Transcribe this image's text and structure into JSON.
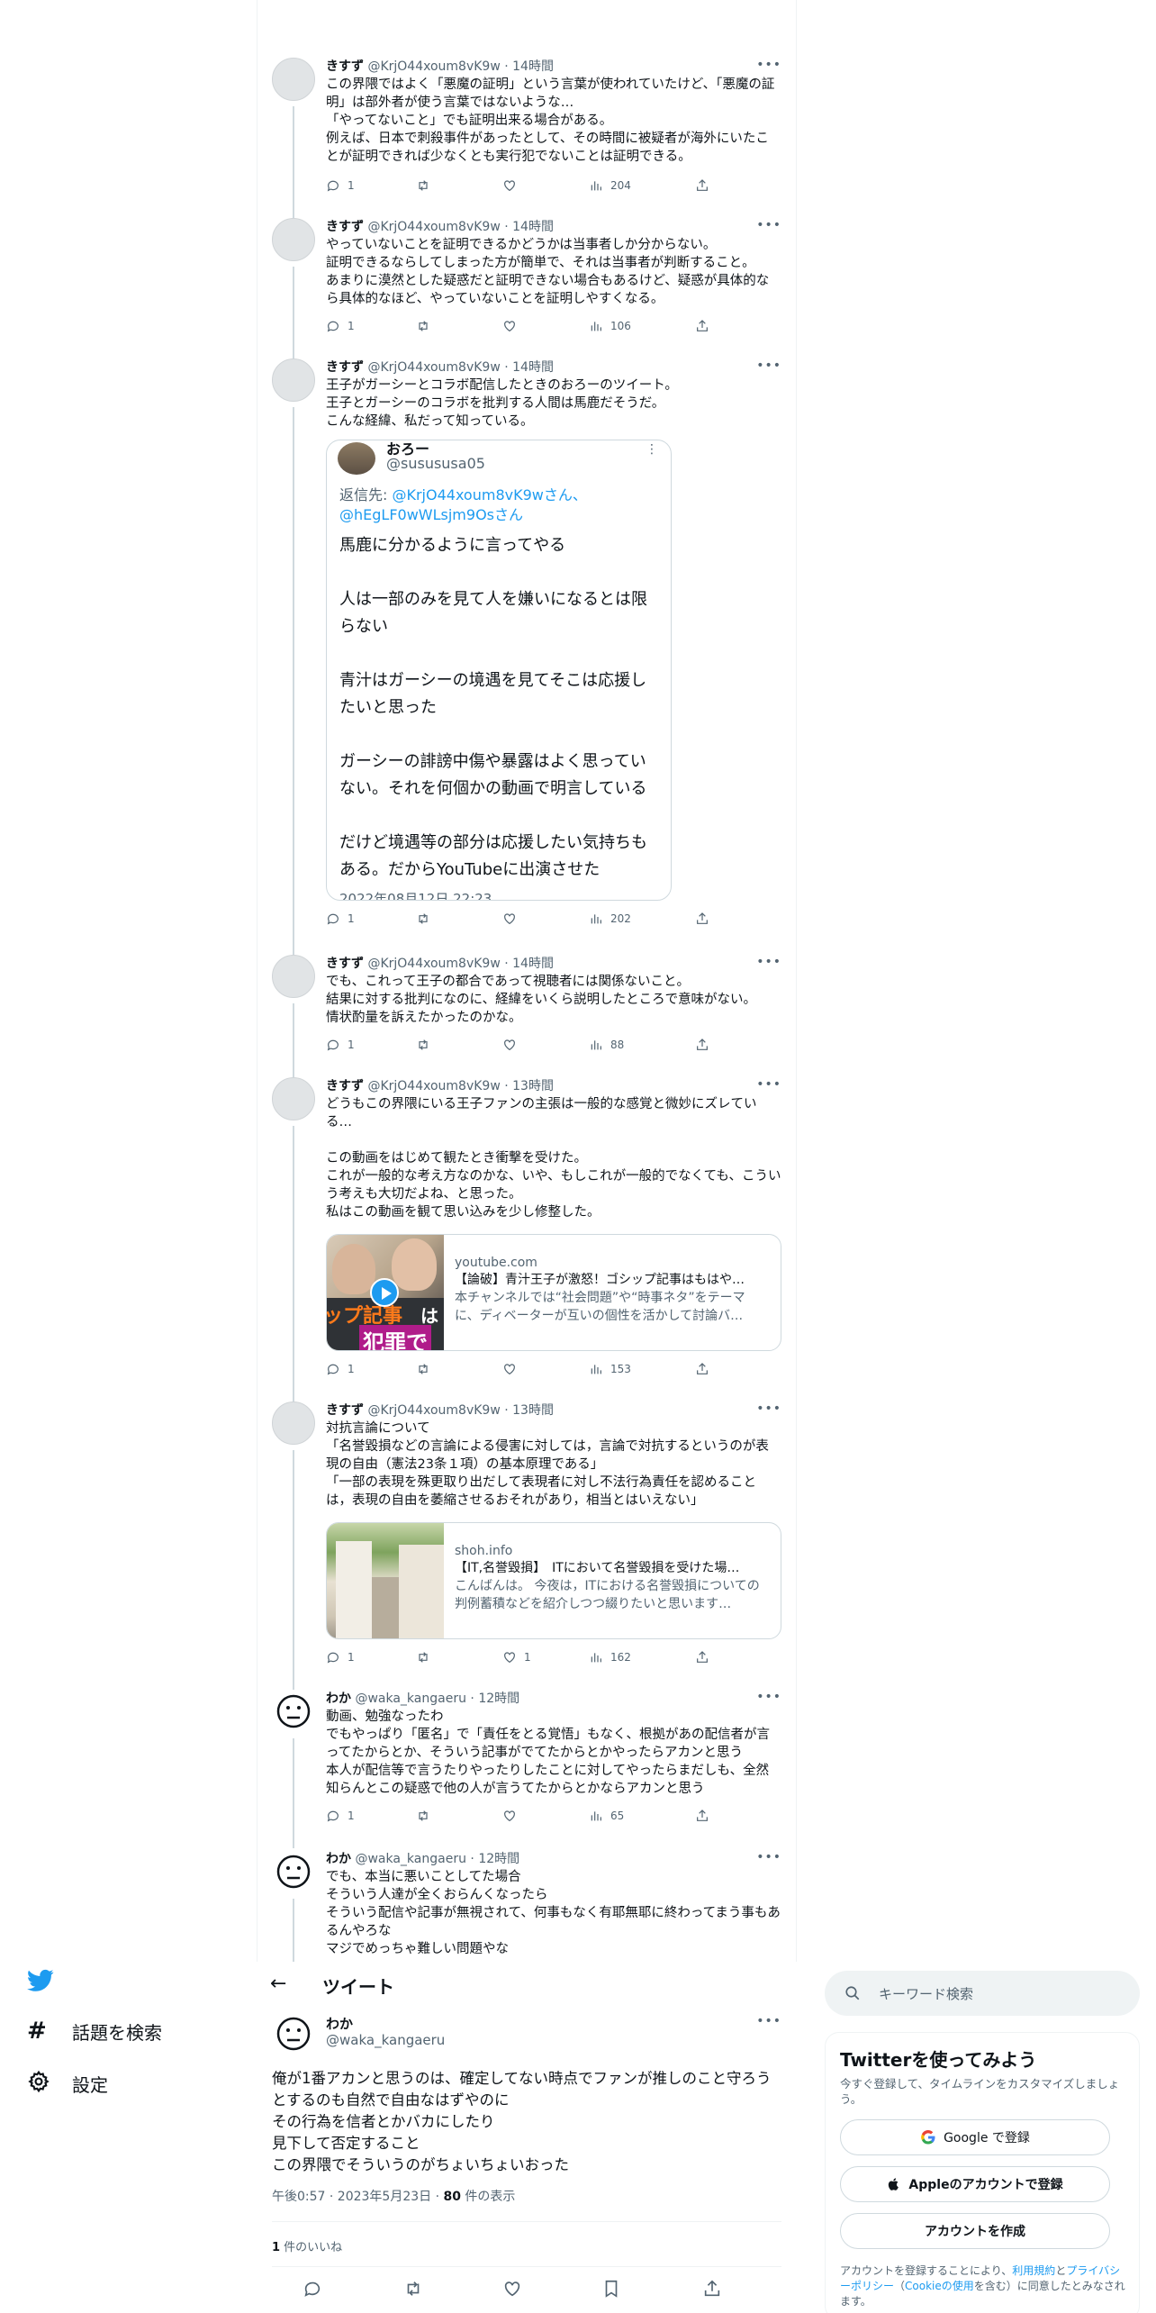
{
  "thread": [
    {
      "name": "きすず",
      "handle": "@KrjO44xoum8vK9w",
      "time": "14時間",
      "text": "この界隈ではよく「悪魔の証明」という言葉が使われていたけど、「悪魔の証明」は部外者が使う言葉ではないような…\n「やってないこと」でも証明出来る場合がある。\n例えば、日本で刺殺事件があったとして、その時間に被疑者が海外にいたことが証明できれば少なくとも実行犯でないことは証明できる。",
      "replies": "1",
      "retweets": "",
      "likes": "",
      "views": "204"
    },
    {
      "name": "きすず",
      "handle": "@KrjO44xoum8vK9w",
      "time": "14時間",
      "text": "やっていないことを証明できるかどうかは当事者しか分からない。\n証明できるならしてしまった方が簡単で、それは当事者が判断すること。\nあまりに漠然とした疑惑だと証明できない場合もあるけど、疑惑が具体的なら具体的なほど、やっていないことを証明しやすくなる。",
      "replies": "1",
      "retweets": "",
      "likes": "",
      "views": "106"
    },
    {
      "name": "きすず",
      "handle": "@KrjO44xoum8vK9w",
      "time": "14時間",
      "text": "王子がガーシーとコラボ配信したときのおろーのツイート。\n王子とガーシーのコラボを批判する人間は馬鹿だそうだ。\nこんな経緯、私だって知っている。",
      "replies": "1",
      "retweets": "",
      "likes": "",
      "views": "202",
      "quote": {
        "name": "おろー",
        "handle": "@susususa05",
        "reply_prefix": "返信先: ",
        "reply_to_1": "@KrjO44xoum8vK9wさん、",
        "reply_to_2": "@hEgLF0wWLsjm9Osさん",
        "text": "馬鹿に分かるように言ってやる\n\n人は一部のみを見て人を嫌いになるとは限らない\n\n青汁はガーシーの境遇を見てそこは応援したいと思った\n\nガーシーの誹謗中傷や暴露はよく思っていない。それを何個かの動画で明言している\n\nだけど境遇等の部分は応援したい気持ちもある。だからYouTubeに出演させた",
        "date": "2022年08月12日 22:23"
      }
    },
    {
      "name": "きすず",
      "handle": "@KrjO44xoum8vK9w",
      "time": "14時間",
      "text": "でも、これって王子の都合であって視聴者には関係ないこと。\n結果に対する批判になのに、経緯をいくら説明したところで意味がない。\n情状酌量を訴えたかったのかな。",
      "replies": "1",
      "retweets": "",
      "likes": "",
      "views": "88"
    },
    {
      "name": "きすず",
      "handle": "@KrjO44xoum8vK9w",
      "time": "13時間",
      "text": "どうもこの界隈にいる王子ファンの主張は一般的な感覚と微妙にズレている…\n\nこの動画をはじめて観たとき衝撃を受けた。\nこれが一般的な考え方なのかな、いや、もしこれが一般的でなくても、こういう考えも大切だよね、と思った。\n私はこの動画を観て思い込みを少し修整した。",
      "replies": "1",
      "retweets": "",
      "likes": "",
      "views": "153",
      "card": {
        "domain": "youtube.com",
        "title": "【論破】青汁王子が激怒！ゴシップ記事はもはや…",
        "desc": "本チャンネルでは“社会問題”や“時事ネタ”をテーマに、ディベーターが互いの個性を活かして討論バ…",
        "thumb_text_1": "ップ記事",
        "thumb_text_2": "は",
        "thumb_text_3": "犯罪で"
      }
    },
    {
      "name": "きすず",
      "handle": "@KrjO44xoum8vK9w",
      "time": "13時間",
      "text": "対抗言論について\n「名誉毀損などの言論による侵害に対しては，言論で対抗するというのが表現の自由（憲法23条１項）の基本原理である」\n「一部の表現を殊更取り出だして表現者に対し不法行為責任を認めることは，表現の自由を萎縮させるおそれがあり，相当とはいえない」",
      "replies": "1",
      "retweets": "",
      "likes": "1",
      "views": "162",
      "card": {
        "domain": "shoh.info",
        "title": "【IT,名誉毀損】　ITにおいて名誉毀損を受けた場…",
        "desc": "こんばんは。 今夜は，ITにおける名誉毀損についての判例蓄積などを紹介しつつ綴りたいと思います…"
      }
    },
    {
      "name": "わか",
      "handle": "@waka_kangaeru",
      "time": "12時間",
      "text": "動画、勉強なったわ\nでもやっぱり「匿名」で「責任をとる覚悟」もなく、根拠があの配信者が言ってたからとか、そういう記事がでてたからとかやったらアカンと思う\n本人が配信等で言うたりやったりしたことに対してやったらまだしも、全然知らんとこの疑惑で他の人が言うてたからとかならアカンと思う",
      "replies": "1",
      "retweets": "",
      "likes": "",
      "views": "65"
    },
    {
      "name": "わか",
      "handle": "@waka_kangaeru",
      "time": "12時間",
      "text": "でも、本当に悪いことしてた場合\nそういう人達が全くおらんくなったら\nそういう配信や記事が無視されて、何事もなく有耶無耶に終わってまう事もあるんやろな\nマジでめっちゃ難しい問題やな"
    }
  ],
  "nav": {
    "explore": "話題を検索",
    "settings": "設定"
  },
  "detail": {
    "header": "ツイート",
    "name": "わか",
    "handle": "@waka_kangaeru",
    "text": "俺が1番アカンと思うのは、確定してない時点でファンが推しのこと守ろうとするのも自然で自由なはずやのに\nその行為を信者とかバカにしたり\n見下して否定すること\nこの界隈でそういうのがちょいちょいおった",
    "time": "午後0:57 · 2023年5月23日 · ",
    "views_count": "80",
    "views_label": " 件の表示",
    "likes_count": "1",
    "likes_label": " 件のいいね"
  },
  "sidebar": {
    "search_placeholder": "キーワード検索",
    "title": "Twitterを使ってみよう",
    "subtitle": "今すぐ登録して、タイムラインをカスタマイズしましょう。",
    "google_btn": "Google で登録",
    "apple_btn": "Appleのアカウントで登録",
    "create_btn": "アカウントを作成",
    "legal_1": "アカウントを登録することにより、",
    "legal_link_1": "利用規約",
    "legal_2": "と",
    "legal_link_2": "プライバシーポリシー",
    "legal_3": "（",
    "legal_link_3": "Cookieの使用",
    "legal_4": "を含む）に同意したとみなされます。"
  },
  "colors": {
    "brand": "#1d9bf0",
    "text": "#0f1419",
    "muted": "#536471",
    "border": "#eff3f4"
  }
}
